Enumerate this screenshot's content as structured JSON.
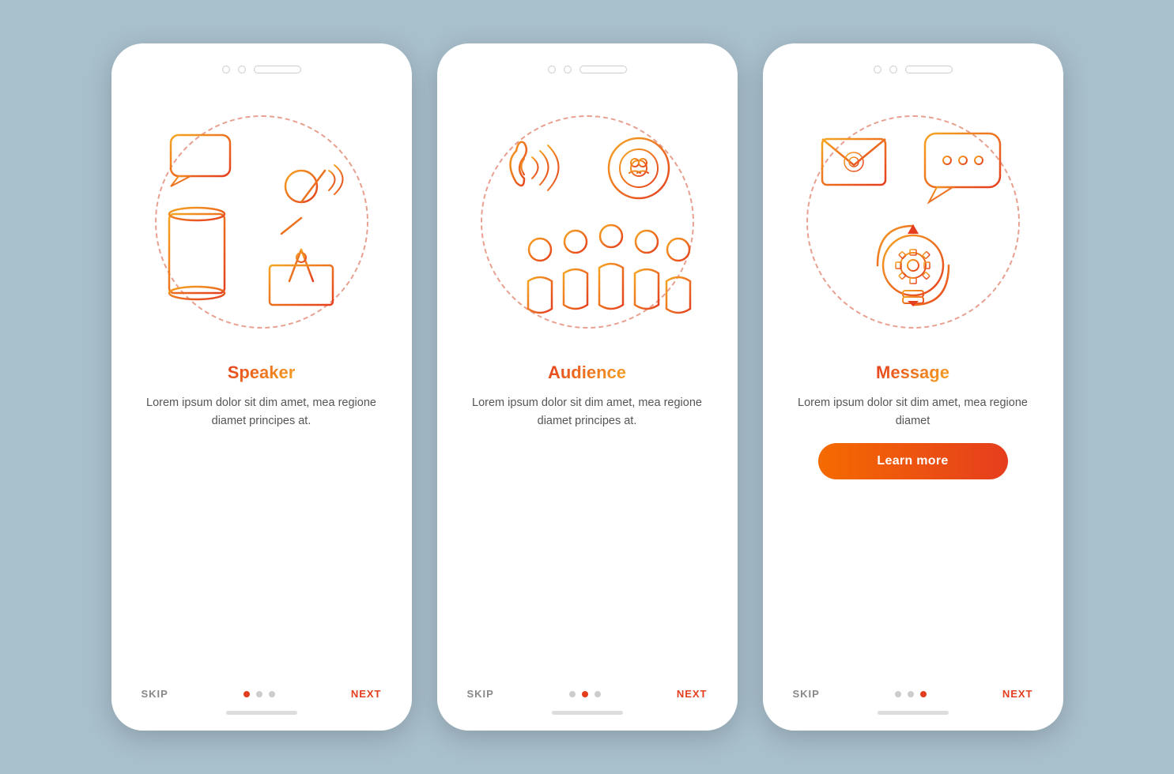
{
  "background_color": "#a8bfcc",
  "cards": [
    {
      "id": "speaker",
      "title": "Speaker",
      "body": "Lorem ipsum dolor sit dim amet, mea regione diamet principes at.",
      "dots": [
        true,
        false,
        false
      ],
      "skip_label": "SKIP",
      "next_label": "NEXT",
      "show_button": false,
      "button_label": ""
    },
    {
      "id": "audience",
      "title": "Audience",
      "body": "Lorem ipsum dolor sit dim amet, mea regione diamet principes at.",
      "dots": [
        false,
        true,
        false
      ],
      "skip_label": "SKIP",
      "next_label": "NEXT",
      "show_button": false,
      "button_label": ""
    },
    {
      "id": "message",
      "title": "Message",
      "body": "Lorem ipsum dolor sit dim amet, mea regione diamet",
      "dots": [
        false,
        false,
        true
      ],
      "skip_label": "SKIP",
      "next_label": "NEXT",
      "show_button": true,
      "button_label": "Learn more"
    }
  ]
}
